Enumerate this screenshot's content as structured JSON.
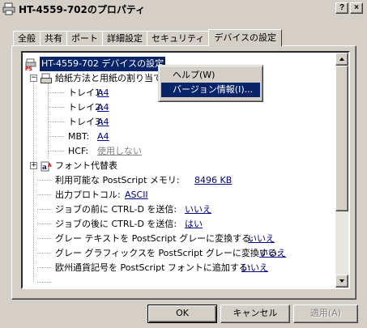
{
  "window": {
    "title": "HT-4559-702のプロパティ",
    "help_btn": "?",
    "close_btn": "×"
  },
  "tabs": [
    {
      "label": "全般"
    },
    {
      "label": "共有"
    },
    {
      "label": "ポート"
    },
    {
      "label": "詳細設定"
    },
    {
      "label": "セキュリティ"
    },
    {
      "label": "デバイスの設定"
    }
  ],
  "tree": {
    "root": "HT-4559-702 デバイスの設定",
    "paper_group": "給紙方法と用紙の割り当て",
    "tray1_label": "トレイ1:",
    "tray1_value": "A4",
    "tray2_label": "トレイ2:",
    "tray2_value": "A4",
    "tray3_label": "トレイ3:",
    "tray3_value": "A4",
    "mbt_label": "MBT:",
    "mbt_value": "A4",
    "hcf_label": "HCF:",
    "hcf_value": "使用しない",
    "font_sub": "フォント代替表",
    "ps_mem_label": "利用可能な PostScript メモリ:",
    "ps_mem_value": "8496 KB",
    "protocol_label": "出力プロトコル:",
    "protocol_value": "ASCII",
    "ctrld_before_label": "ジョブの前に CTRL-D を送信:",
    "ctrld_before_value": "いいえ",
    "ctrld_after_label": "ジョブの後に CTRL-D を送信:",
    "ctrld_after_value": "はい",
    "gray_text_label": "グレー テキストを PostScript グレーに変換する:",
    "gray_text_value": "いいえ",
    "gray_gfx_label": "グレー グラフィックスを PostScript グレーに変換する:",
    "gray_gfx_value": "いいえ",
    "euro_label": "欧州通貨記号を PostScript フォントに追加する:",
    "euro_value": "いいえ"
  },
  "context_menu": {
    "help": "ヘルプ(W)",
    "version": "バージョン情報(I)..."
  },
  "buttons": {
    "ok": "OK",
    "cancel": "キャンセル",
    "apply": "適用(A)"
  }
}
